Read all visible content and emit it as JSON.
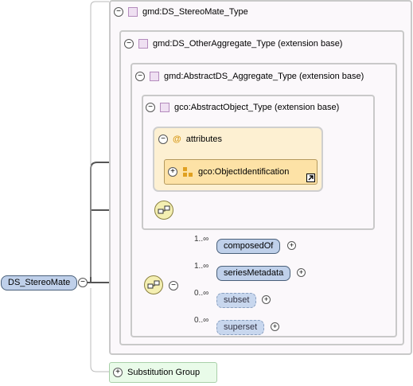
{
  "root": {
    "label": "DS_StereoMate"
  },
  "types": [
    {
      "label": "gmd:DS_StereoMate_Type"
    },
    {
      "label": "gmd:DS_OtherAggregate_Type (extension base)"
    },
    {
      "label": "gmd:AbstractDS_Aggregate_Type (extension base)"
    },
    {
      "label": "gco:AbstractObject_Type (extension base)"
    }
  ],
  "attributes": {
    "symbol": "@",
    "label": "attributes",
    "child": "gco:ObjectIdentification"
  },
  "elements": [
    {
      "label": "composedOf",
      "cardinality": "1..∞"
    },
    {
      "label": "seriesMetadata",
      "cardinality": "1..∞"
    },
    {
      "label": "subset",
      "cardinality": "0..∞"
    },
    {
      "label": "superset",
      "cardinality": "0..∞"
    }
  ],
  "substitution_group": {
    "label": "Substitution Group"
  },
  "toggle": {
    "collapse": "−",
    "expand": "+"
  }
}
